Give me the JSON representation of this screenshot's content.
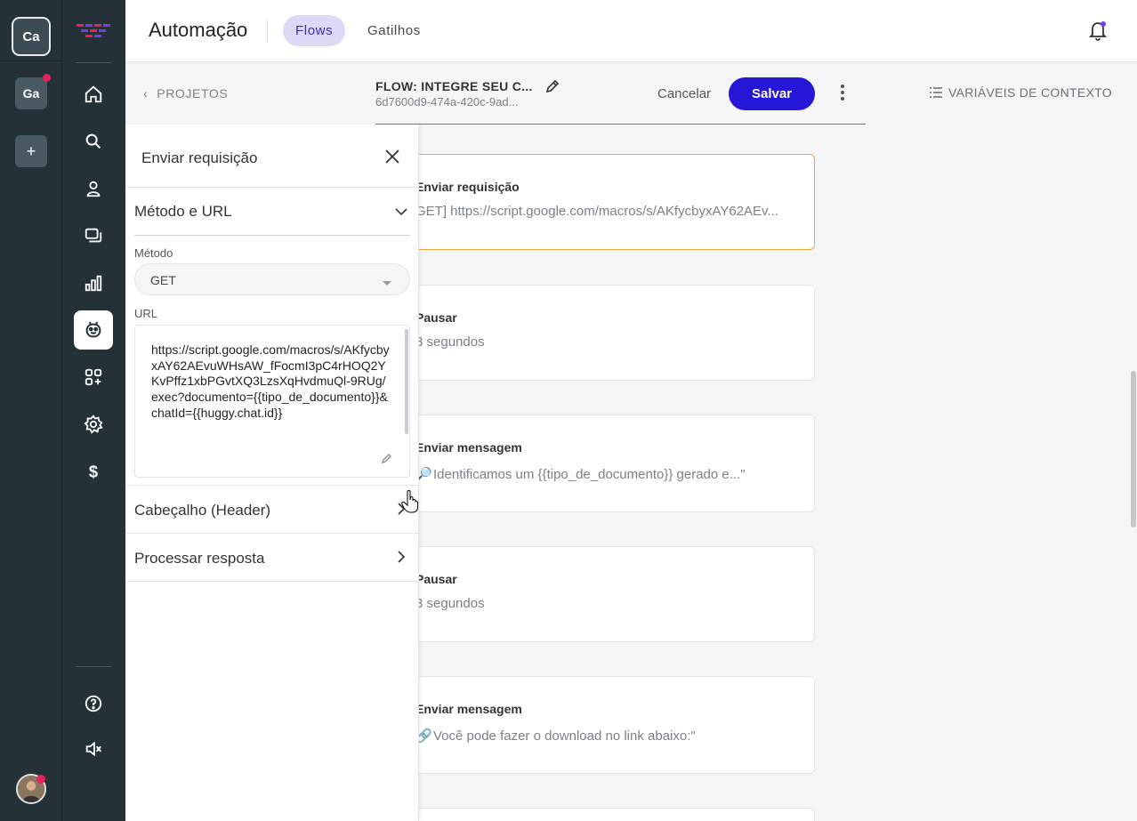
{
  "workspaces": [
    {
      "label": "Ca",
      "active": true
    },
    {
      "label": "Ga",
      "active": false,
      "notification": true
    },
    {
      "label": "+",
      "active": false
    }
  ],
  "nav": {
    "items": [
      "home-icon",
      "search-icon",
      "contacts-icon",
      "chats-icon",
      "reports-icon",
      "automation-icon",
      "apps-icon",
      "settings-icon",
      "billing-icon"
    ],
    "selected": "automation-icon",
    "bottom": [
      "help-icon",
      "sound-muted-icon"
    ]
  },
  "header": {
    "title": "Automação",
    "tabs": [
      {
        "label": "Flows",
        "active": true
      },
      {
        "label": "Gatilhos",
        "active": false
      }
    ]
  },
  "flowbar": {
    "back_label": "PROJETOS",
    "flow_title": "FLOW: INTEGRE SEU C...",
    "flow_id": "6d7600d9-474a-420c-9ad...",
    "cancel_label": "Cancelar",
    "save_label": "Salvar",
    "context_vars_label": "VARIÁVEIS DE CONTEXTO"
  },
  "panel": {
    "title": "Enviar requisição",
    "section_method": "Método e URL",
    "method_label": "Método",
    "method_value": "GET",
    "url_label": "URL",
    "url_value": "https://script.google.com/macros/s/AKfycbyxAY62AEvuWHsAW_fFocmI3pC4rHOQ2YKvPffz1xbPGvtXQ3LzsXqHvdmuQl-9RUg/exec?documento={{tipo_de_documento}}&chatId={{huggy.chat.id}}",
    "section_header": "Cabeçalho (Header)",
    "section_response": "Processar resposta"
  },
  "cards": [
    {
      "title": "Enviar requisição",
      "desc": "GET] https://script.google.com/macros/s/AKfycbyxAY62AEv...",
      "highlighted": true
    },
    {
      "title": "Pausar",
      "desc": "3 segundos"
    },
    {
      "title": "Enviar mensagem",
      "emoji": "🔎",
      "desc": "Identificamos um {{tipo_de_documento}} gerado e...\""
    },
    {
      "title": "Pausar",
      "desc": "3 segundos"
    },
    {
      "title": "Enviar mensagem",
      "emoji": "🔗",
      "desc": "Você pode fazer o download no link abaixo:\""
    }
  ],
  "colors": {
    "primary": "#2617d6",
    "rail": "#243238",
    "highlight": "#f2a640",
    "badge": "#e8205c"
  }
}
